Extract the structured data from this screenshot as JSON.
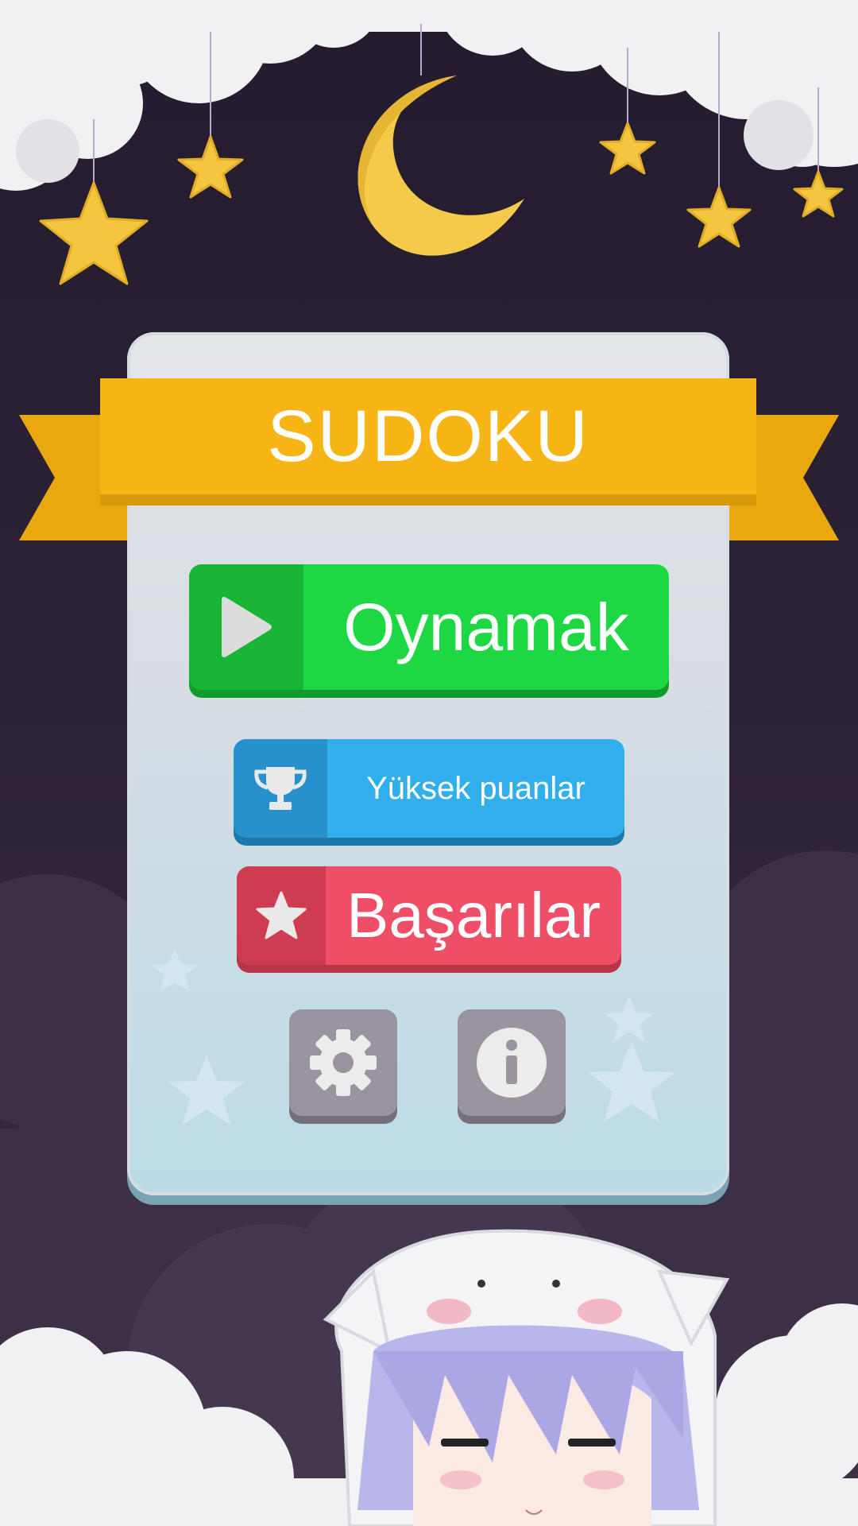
{
  "title": "SUDOKU",
  "buttons": {
    "play": {
      "label": "Oynamak",
      "icon": "play-icon"
    },
    "high_scores": {
      "label": "Yüksek puanlar",
      "icon": "trophy-icon"
    },
    "achievements": {
      "label": "Başarılar",
      "icon": "star-icon"
    },
    "settings": {
      "icon": "gear-icon"
    },
    "info": {
      "icon": "info-icon"
    }
  },
  "colors": {
    "ribbon": "#f6b514",
    "play": "#1ed843",
    "high_scores": "#31aeec",
    "achievements": "#ef4f66",
    "square_buttons": "#99949d",
    "background": "#2c2236"
  }
}
